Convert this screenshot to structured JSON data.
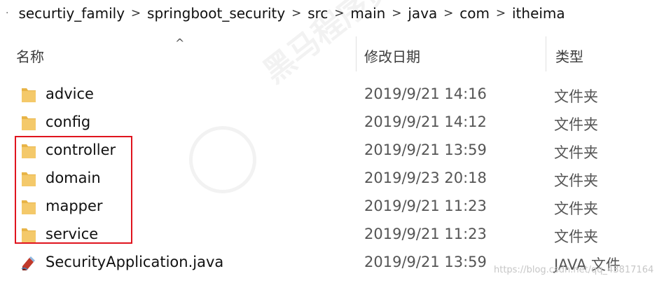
{
  "breadcrumb": {
    "items": [
      "securtiy_family",
      "springboot_security",
      "src",
      "main",
      "java",
      "com",
      "itheima"
    ],
    "separator": ">"
  },
  "columns": {
    "name": "名称",
    "date": "修改日期",
    "type": "类型",
    "sort_indicator": "^"
  },
  "files": [
    {
      "name": "advice",
      "date": "2019/9/21 14:16",
      "type": "文件夹",
      "icon": "folder-icon"
    },
    {
      "name": "config",
      "date": "2019/9/21 14:12",
      "type": "文件夹",
      "icon": "folder-icon"
    },
    {
      "name": "controller",
      "date": "2019/9/21 13:59",
      "type": "文件夹",
      "icon": "folder-icon"
    },
    {
      "name": "domain",
      "date": "2019/9/23 20:18",
      "type": "文件夹",
      "icon": "folder-icon"
    },
    {
      "name": "mapper",
      "date": "2019/9/21 11:23",
      "type": "文件夹",
      "icon": "folder-icon"
    },
    {
      "name": "service",
      "date": "2019/9/21 11:23",
      "type": "文件夹",
      "icon": "folder-icon"
    },
    {
      "name": "SecurityApplication.java",
      "date": "2019/9/21 13:59",
      "type": "JAVA 文件",
      "icon": "java-file-icon"
    }
  ],
  "watermark": {
    "text": "黑马程序员 www.itheima.com",
    "csdn": "https://blog.csdn.net/qq_43817164"
  },
  "colors": {
    "highlight_border": "#e0141e",
    "folder": "#f4c96a"
  }
}
